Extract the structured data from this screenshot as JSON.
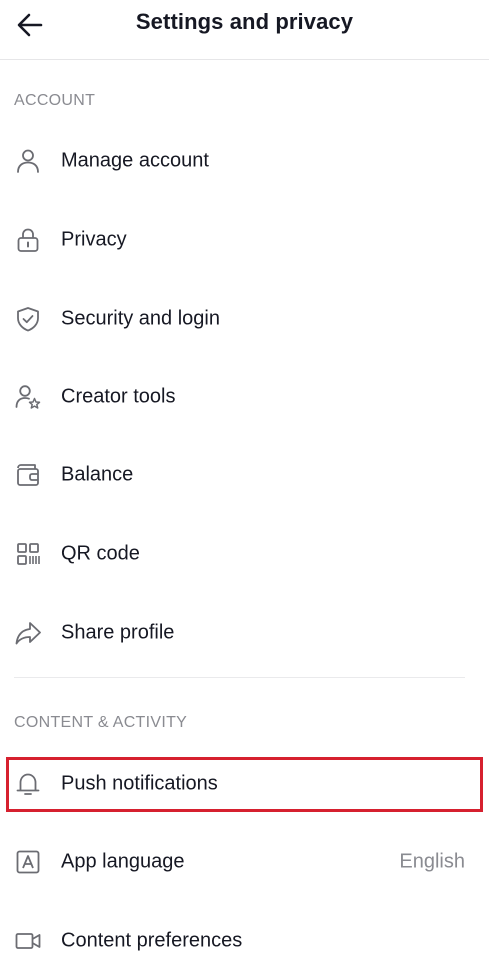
{
  "header": {
    "title": "Settings and privacy",
    "back_icon": "arrow-left-icon"
  },
  "sections": [
    {
      "title": "ACCOUNT",
      "items": [
        {
          "label": "Manage account",
          "icon": "person-icon"
        },
        {
          "label": "Privacy",
          "icon": "lock-icon"
        },
        {
          "label": "Security and login",
          "icon": "shield-check-icon"
        },
        {
          "label": "Creator tools",
          "icon": "person-star-icon"
        },
        {
          "label": "Balance",
          "icon": "wallet-icon"
        },
        {
          "label": "QR code",
          "icon": "qr-code-icon"
        },
        {
          "label": "Share profile",
          "icon": "share-arrow-icon"
        }
      ]
    },
    {
      "title": "CONTENT & ACTIVITY",
      "items": [
        {
          "label": "Push notifications",
          "icon": "bell-icon",
          "highlighted": true
        },
        {
          "label": "App language",
          "icon": "language-icon",
          "value": "English"
        },
        {
          "label": "Content preferences",
          "icon": "video-camera-icon"
        }
      ]
    }
  ],
  "colors": {
    "text": "#161823",
    "muted": "#8a8b91",
    "highlight_border": "#d6202f"
  }
}
